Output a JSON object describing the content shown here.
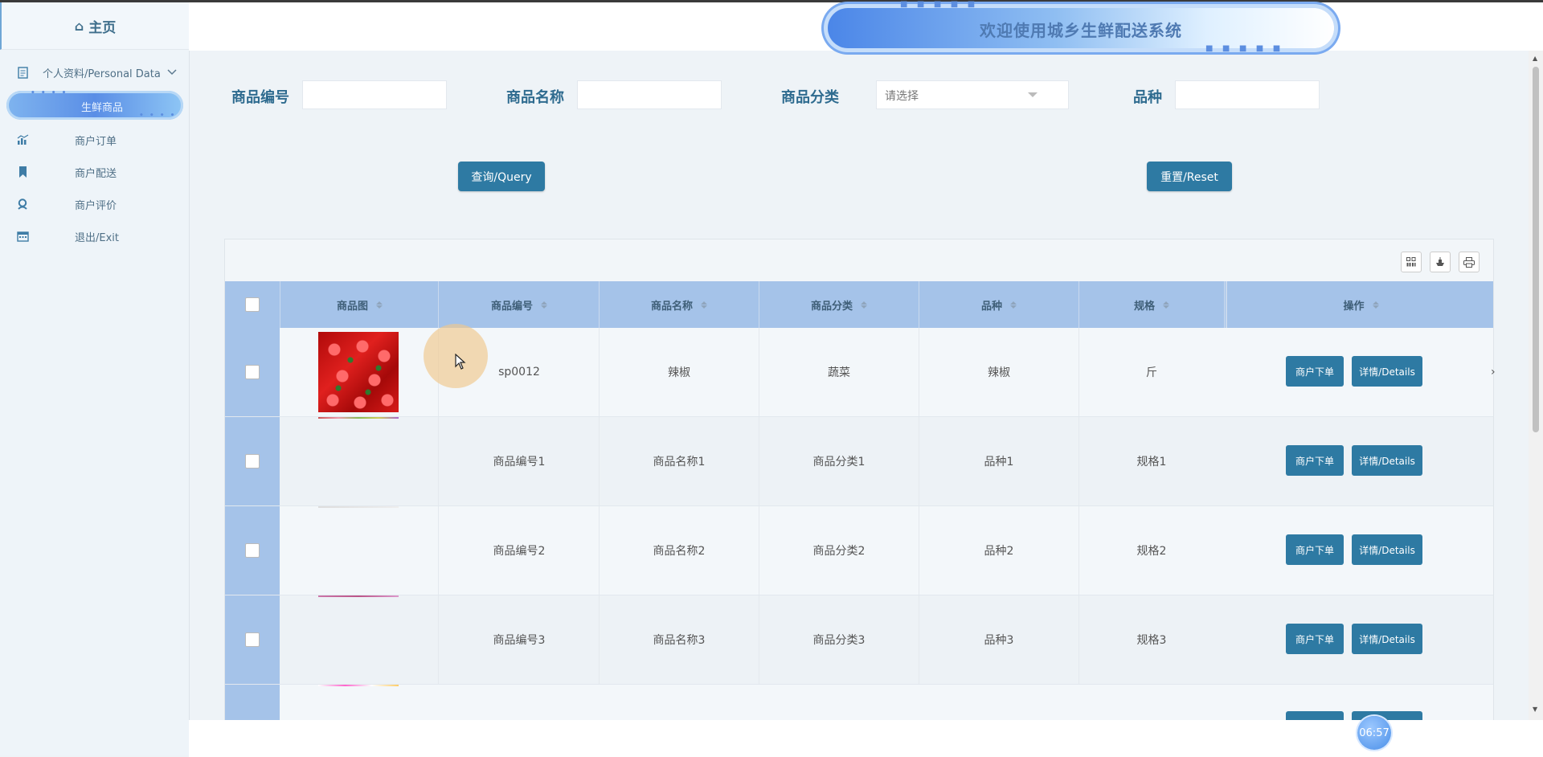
{
  "sidebar": {
    "home": "主页",
    "items": [
      {
        "label": "个人资料/Personal Data",
        "icon": "document-icon"
      },
      {
        "label": "生鲜商品",
        "icon": "none",
        "active": true
      },
      {
        "label": "商户订单",
        "icon": "chart-icon"
      },
      {
        "label": "商户配送",
        "icon": "bookmark-icon"
      },
      {
        "label": "商户评价",
        "icon": "user-badge-icon"
      },
      {
        "label": "退出/Exit",
        "icon": "calendar-icon"
      }
    ],
    "active_dots": "• • • •"
  },
  "header": {
    "title": "欢迎使用城乡生鲜配送系统",
    "dots": "■ ■ ■ ■ ■"
  },
  "search": {
    "code_label": "商品编号",
    "name_label": "商品名称",
    "category_label": "商品分类",
    "category_placeholder": "请选择",
    "variety_label": "品种",
    "query_button": "查询/Query",
    "reset_button": "重置/Reset"
  },
  "table": {
    "columns": [
      "商品图",
      "商品编号",
      "商品名称",
      "商品分类",
      "品种",
      "规格",
      "操作"
    ],
    "rows": [
      {
        "code": "sp0012",
        "name": "辣椒",
        "category": "蔬菜",
        "variety": "辣椒",
        "spec": "斤"
      },
      {
        "code": "商品编号1",
        "name": "商品名称1",
        "category": "商品分类1",
        "variety": "品种1",
        "spec": "规格1"
      },
      {
        "code": "商品编号2",
        "name": "商品名称2",
        "category": "商品分类2",
        "variety": "品种2",
        "spec": "规格2"
      },
      {
        "code": "商品编号3",
        "name": "商品名称3",
        "category": "商品分类3",
        "variety": "品种3",
        "spec": "规格3"
      }
    ],
    "order_button": "商户下单",
    "details_button": "详情/Details"
  },
  "clock": "06:57"
}
